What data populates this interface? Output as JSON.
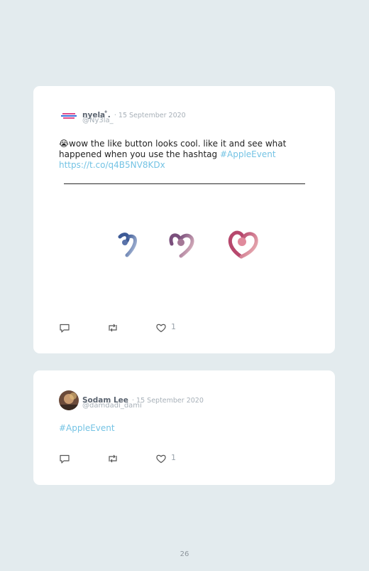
{
  "tweets": [
    {
      "name": "nyela ̊.",
      "date": "· 15 September 2020",
      "handle": "@Ny3la_",
      "emoji": "😭",
      "text": "wow the like button looks cool. like it and see what happened when you use the hashtag ",
      "hashtag": "#AppleEvent",
      "url": "https://t.co/q4B5NV8KDx",
      "like_count": "1"
    },
    {
      "name": "Sodam Lee",
      "date": "· 15 September 2020",
      "handle": "@damdadi_dami",
      "hashtag": "#AppleEvent",
      "like_count": "1"
    }
  ],
  "page_number": "26",
  "colors": {
    "link": "#74c3e4",
    "background": "#e3ebee"
  },
  "icons": [
    "reply-icon",
    "retweet-icon",
    "like-icon"
  ]
}
